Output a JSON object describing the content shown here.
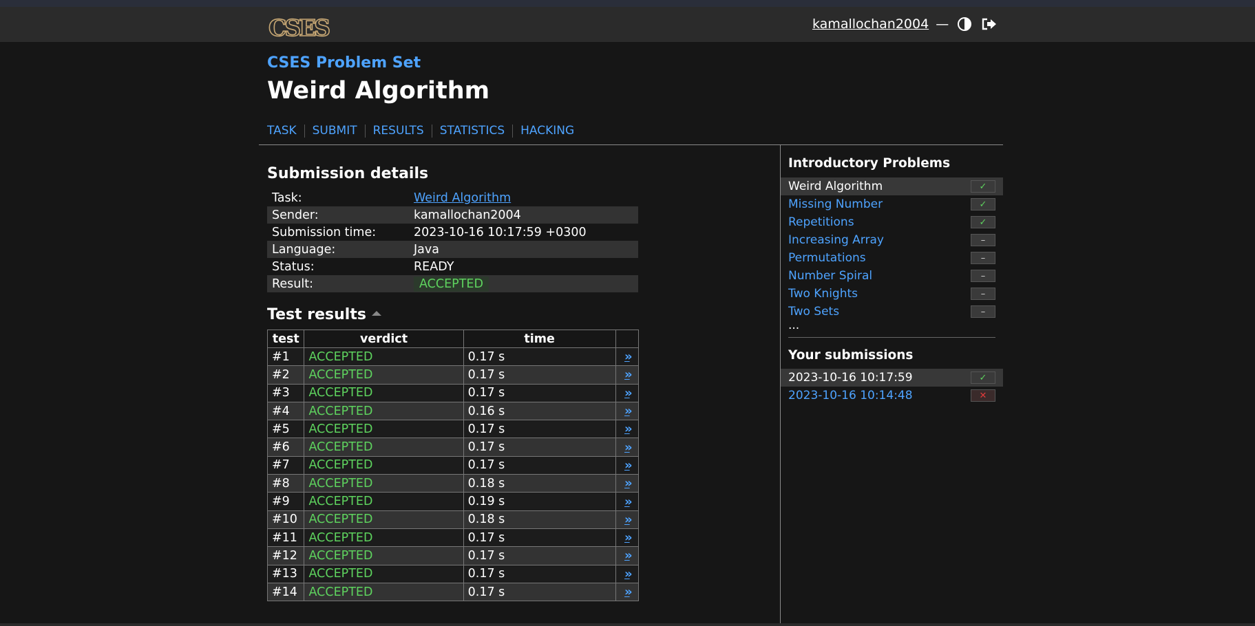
{
  "header": {
    "logo_text": "CSES",
    "username": "kamallochan2004",
    "dash": "—"
  },
  "breadcrumb": "CSES Problem Set",
  "page_title": "Weird Algorithm",
  "tabs": [
    "TASK",
    "SUBMIT",
    "RESULTS",
    "STATISTICS",
    "HACKING"
  ],
  "submission": {
    "heading": "Submission details",
    "rows": [
      {
        "key": "Task:",
        "value": "Weird Algorithm"
      },
      {
        "key": "Sender:",
        "value": "kamallochan2004"
      },
      {
        "key": "Submission time:",
        "value": "2023-10-16 10:17:59 +0300"
      },
      {
        "key": "Language:",
        "value": "Java"
      },
      {
        "key": "Status:",
        "value": "READY"
      },
      {
        "key": "Result:",
        "value": "ACCEPTED"
      }
    ]
  },
  "tests": {
    "heading": "Test results",
    "columns": [
      "test",
      "verdict",
      "time"
    ],
    "rows": [
      {
        "test": "#1",
        "verdict": "ACCEPTED",
        "time": "0.17 s"
      },
      {
        "test": "#2",
        "verdict": "ACCEPTED",
        "time": "0.17 s"
      },
      {
        "test": "#3",
        "verdict": "ACCEPTED",
        "time": "0.17 s"
      },
      {
        "test": "#4",
        "verdict": "ACCEPTED",
        "time": "0.16 s"
      },
      {
        "test": "#5",
        "verdict": "ACCEPTED",
        "time": "0.17 s"
      },
      {
        "test": "#6",
        "verdict": "ACCEPTED",
        "time": "0.17 s"
      },
      {
        "test": "#7",
        "verdict": "ACCEPTED",
        "time": "0.17 s"
      },
      {
        "test": "#8",
        "verdict": "ACCEPTED",
        "time": "0.18 s"
      },
      {
        "test": "#9",
        "verdict": "ACCEPTED",
        "time": "0.19 s"
      },
      {
        "test": "#10",
        "verdict": "ACCEPTED",
        "time": "0.18 s"
      },
      {
        "test": "#11",
        "verdict": "ACCEPTED",
        "time": "0.17 s"
      },
      {
        "test": "#12",
        "verdict": "ACCEPTED",
        "time": "0.17 s"
      },
      {
        "test": "#13",
        "verdict": "ACCEPTED",
        "time": "0.17 s"
      },
      {
        "test": "#14",
        "verdict": "ACCEPTED",
        "time": "0.17 s"
      }
    ],
    "view_glyph": "»"
  },
  "sidebar": {
    "problems_heading": "Introductory Problems",
    "problems": [
      {
        "name": "Weird Algorithm",
        "status": "solved",
        "current": true
      },
      {
        "name": "Missing Number",
        "status": "solved",
        "current": false
      },
      {
        "name": "Repetitions",
        "status": "solved",
        "current": false
      },
      {
        "name": "Increasing Array",
        "status": "none",
        "current": false
      },
      {
        "name": "Permutations",
        "status": "none",
        "current": false
      },
      {
        "name": "Number Spiral",
        "status": "none",
        "current": false
      },
      {
        "name": "Two Knights",
        "status": "none",
        "current": false
      },
      {
        "name": "Two Sets",
        "status": "none",
        "current": false
      }
    ],
    "more": "...",
    "submissions_heading": "Your submissions",
    "submissions": [
      {
        "time": "2023-10-16 10:17:59",
        "status": "accepted",
        "current": true
      },
      {
        "time": "2023-10-16 10:14:48",
        "status": "failed",
        "current": false
      }
    ],
    "glyphs": {
      "solved": "✓",
      "none": "–",
      "accepted": "✓",
      "failed": "✕"
    }
  },
  "colors": {
    "accent": "#4ea3ff",
    "accepted": "#5ed35e",
    "failed": "#e03b3b",
    "background": "#161616"
  }
}
